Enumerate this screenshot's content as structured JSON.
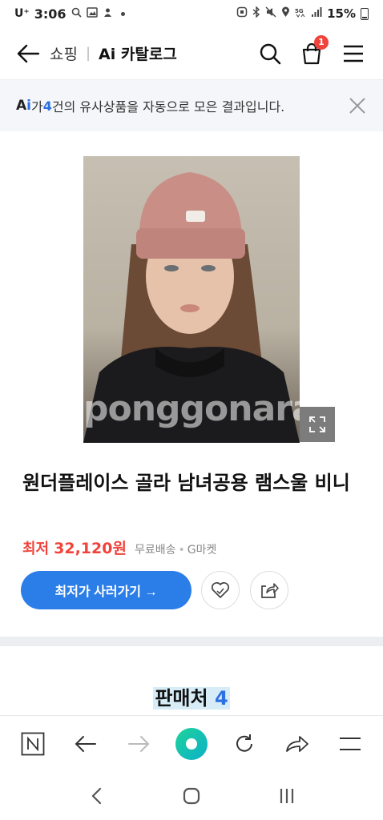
{
  "status_bar": {
    "carrier": "U⁺",
    "time": "3:06",
    "battery": "15%"
  },
  "header": {
    "breadcrumb_shop": "쇼핑",
    "breadcrumb_title": "Ai 카탈로그",
    "cart_count": "1"
  },
  "ai_banner": {
    "logo_a": "A",
    "logo_i": "i",
    "text_before": "가 ",
    "count": "4",
    "text_after": "건의 유사상품을 자동으로 모은 결과입니다."
  },
  "product": {
    "watermark": "ponggonara",
    "name": "원더플레이스 골라 남녀공용 램스울 비니",
    "price_label": "최저",
    "price": "32,120원",
    "shipping": "무료배송",
    "seller": "G마켓",
    "cta_label": "최저가 사러가기 →"
  },
  "sellers": {
    "title": "판매처",
    "count": "4"
  },
  "colors": {
    "accent_blue": "#2b7ee8",
    "price_red": "#f0433b",
    "banner_bg": "#f4f6f9",
    "naver_green": "#1fd39a"
  }
}
